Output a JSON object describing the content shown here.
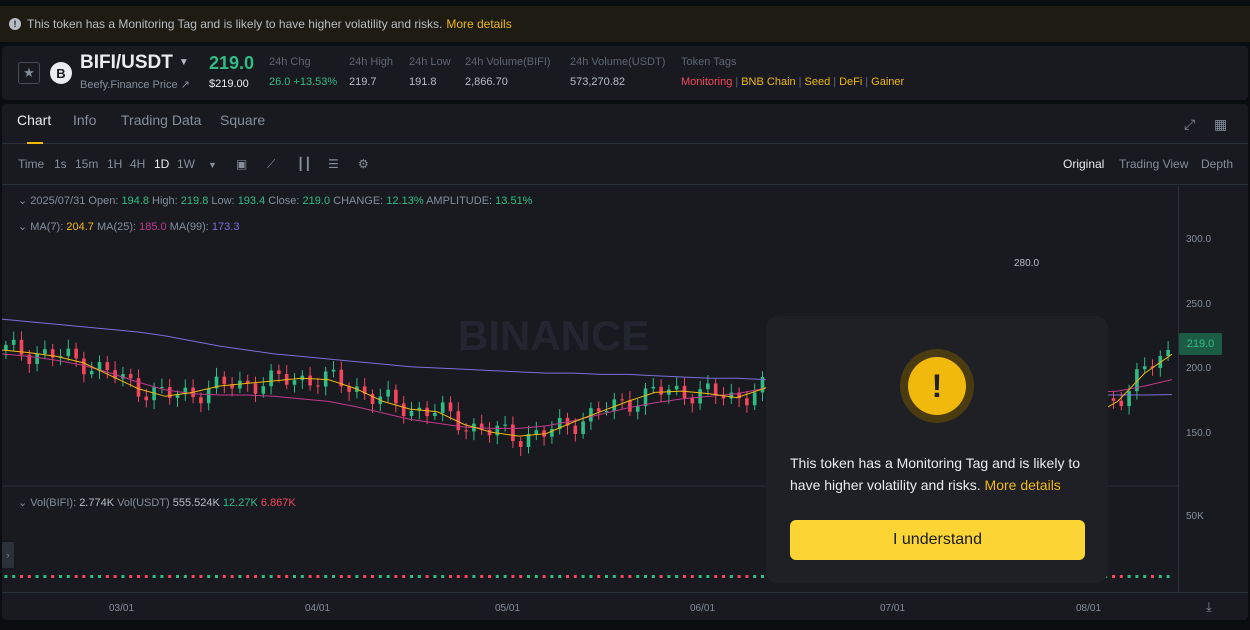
{
  "banner": {
    "text": "This token has a Monitoring Tag and is likely to have higher volatility and risks.",
    "more": "More details"
  },
  "ticker": {
    "pair": "BIFI/USDT",
    "subtitle": "Beefy.Finance Price ↗",
    "last": "219.0",
    "last_usd": "$219.00",
    "stats": [
      {
        "label": "24h Chg",
        "value": "26.0 +13.53%"
      },
      {
        "label": "24h High",
        "value": "219.7"
      },
      {
        "label": "24h Low",
        "value": "191.8"
      },
      {
        "label": "24h Volume(BIFI)",
        "value": "2,866.70"
      },
      {
        "label": "24h Volume(USDT)",
        "value": "573,270.82"
      }
    ],
    "tags_label": "Token Tags",
    "tags": [
      "Monitoring",
      "BNB Chain",
      "Seed",
      "DeFi",
      "Gainer"
    ]
  },
  "tabs": [
    "Chart",
    "Info",
    "Trading Data",
    "Square"
  ],
  "toolbar": {
    "intervals": [
      "Time",
      "1s",
      "15m",
      "1H",
      "4H",
      "1D",
      "1W"
    ],
    "active_interval": "1D",
    "views": [
      "Original",
      "Trading View",
      "Depth"
    ]
  },
  "ohlc": {
    "date": "2025/07/31",
    "open_label": "Open:",
    "open": "194.8",
    "high_label": "High:",
    "high": "219.8",
    "low_label": "Low:",
    "low": "193.4",
    "close_label": "Close:",
    "close": "219.0",
    "change_label": "CHANGE:",
    "change": "12.13%",
    "amp_label": "AMPLITUDE:",
    "amp": "13.51%"
  },
  "ma": {
    "ma7_label": "MA(7):",
    "ma7": "204.7",
    "ma25_label": "MA(25):",
    "ma25": "185.0",
    "ma99_label": "MA(99):",
    "ma99": "173.3"
  },
  "vol": {
    "label": "Vol(BIFI):",
    "bifi": "2.774K",
    "usdt_label": "Vol(USDT)",
    "usdt": "555.524K",
    "v1": "12.27K",
    "v2": "6.867K"
  },
  "watermark": "BINANCE",
  "price_tag": "219.0",
  "peak_label": "280.0",
  "y_ticks": [
    "300.0",
    "250.0",
    "200.0",
    "150.0"
  ],
  "vol_tick": "50K",
  "x_ticks": [
    "03/01",
    "04/01",
    "05/01",
    "06/01",
    "07/01",
    "08/01"
  ],
  "modal": {
    "text": "This token has a Monitoring Tag and is likely to have higher volatility and risks.",
    "more": "More details",
    "button": "I understand"
  },
  "colors": {
    "up": "#2ebd85",
    "down": "#f6465d",
    "accent": "#f0b90b"
  },
  "chart_data": {
    "type": "candlestick",
    "interval": "1D",
    "ma7_close": [
      208,
      206,
      203,
      198,
      188,
      178,
      172,
      175,
      180,
      182,
      184,
      186,
      185,
      178,
      168,
      162,
      160,
      150,
      144,
      141,
      143,
      152,
      160,
      168,
      175,
      176,
      174,
      171,
      178,
      190,
      198,
      198,
      194,
      188,
      179,
      171,
      166,
      163,
      160,
      158,
      156,
      168,
      190,
      204.7
    ],
    "ma25": [
      205,
      203,
      200,
      196,
      190,
      183,
      177,
      174,
      173,
      173,
      172,
      170,
      168,
      164,
      159,
      154,
      151,
      148,
      147,
      147,
      149,
      153,
      158,
      163,
      167,
      170,
      172,
      174,
      178,
      183,
      188,
      192,
      193,
      192,
      190,
      187,
      184,
      181,
      178,
      176,
      175,
      176,
      180,
      185
    ],
    "ma99": [
      232,
      230,
      228,
      226,
      224,
      222,
      219,
      215,
      211,
      208,
      205,
      203,
      201,
      199,
      197,
      195,
      194,
      193,
      192,
      191,
      190,
      190,
      189,
      189,
      188,
      187,
      186,
      186,
      185,
      184,
      183,
      182,
      180,
      179,
      178,
      177,
      176,
      175,
      174,
      174,
      173,
      173,
      173,
      173.3
    ],
    "ylim": [
      110,
      320
    ],
    "vol_max": 50000
  }
}
